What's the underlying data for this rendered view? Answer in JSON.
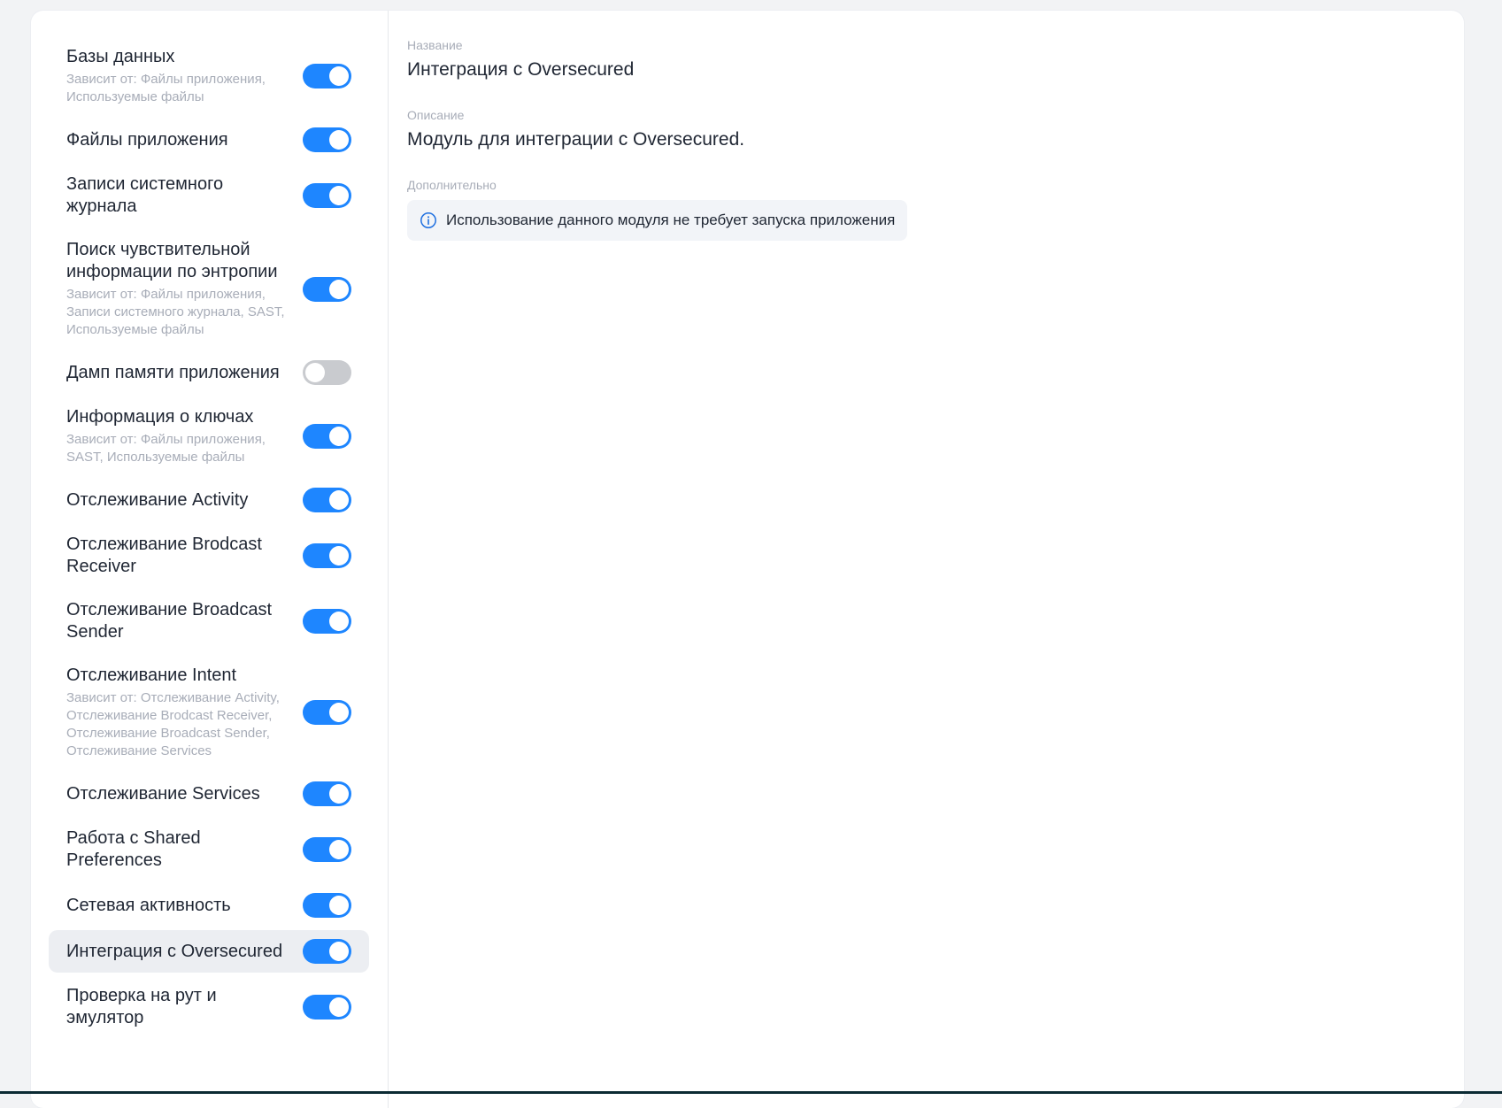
{
  "modules": [
    {
      "title": "Базы данных",
      "deps": "Зависит от:  Файлы приложения, Используемые файлы",
      "enabled": true
    },
    {
      "title": "Файлы приложения",
      "deps": "",
      "enabled": true
    },
    {
      "title": "Записи системного журнала",
      "deps": "",
      "enabled": true
    },
    {
      "title": "Поиск чувствительной информации по энтропии",
      "deps": "Зависит от:  Файлы приложения, Записи системного журнала, SAST, Используемые файлы",
      "enabled": true
    },
    {
      "title": "Дамп памяти приложения",
      "deps": "",
      "enabled": false
    },
    {
      "title": "Информация о ключах",
      "deps": "Зависит от:  Файлы приложения, SAST, Используемые файлы",
      "enabled": true
    },
    {
      "title": "Отслеживание Activity",
      "deps": "",
      "enabled": true
    },
    {
      "title": "Отслеживание Brodcast Receiver",
      "deps": "",
      "enabled": true
    },
    {
      "title": "Отслеживание Broadcast Sender",
      "deps": "",
      "enabled": true
    },
    {
      "title": "Отслеживание Intent",
      "deps": "Зависит от:  Отслеживание Activity, Отслеживание Brodcast Receiver, Отслеживание Broadcast Sender, Отслеживание Services",
      "enabled": true
    },
    {
      "title": "Отслеживание Services",
      "deps": "",
      "enabled": true
    },
    {
      "title": "Работа с Shared Preferences",
      "deps": "",
      "enabled": true
    },
    {
      "title": "Сетевая активность",
      "deps": "",
      "enabled": true
    },
    {
      "title": "Интеграция с Oversecured",
      "deps": "",
      "enabled": true,
      "selected": true
    },
    {
      "title": "Проверка на рут и эмулятор",
      "deps": "",
      "enabled": true
    }
  ],
  "details": {
    "name_label": "Название",
    "name_value": "Интеграция с Oversecured",
    "description_label": "Описание",
    "description_value": "Модуль для интеграции с Oversecured.",
    "extra_label": "Дополнительно",
    "info_text": "Использование данного модуля не требует запуска приложения",
    "info_icon": "info-circle-icon"
  },
  "colors": {
    "accent": "#1e86ff",
    "toggle_off": "#c9cbcf",
    "selected_row": "#eceef2"
  }
}
